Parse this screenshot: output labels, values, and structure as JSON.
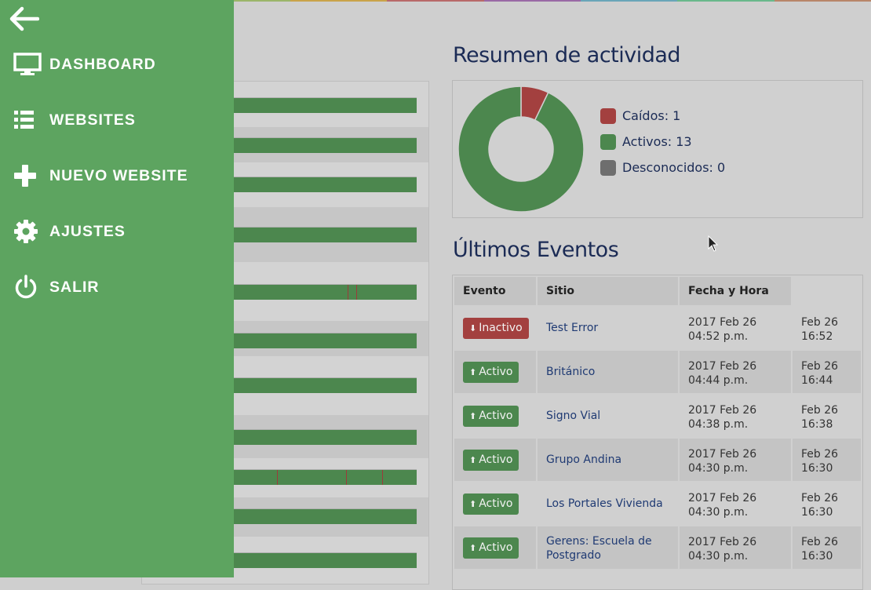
{
  "nav": {
    "items": [
      {
        "label": "DASHBOARD",
        "icon": "monitor-icon"
      },
      {
        "label": "WEBSITES",
        "icon": "list-icon"
      },
      {
        "label": "NUEVO WEBSITE",
        "icon": "plus-icon"
      },
      {
        "label": "AJUSTES",
        "icon": "gear-icon"
      },
      {
        "label": "SALIR",
        "icon": "power-icon"
      }
    ]
  },
  "summary": {
    "title": "Resumen de actividad",
    "legend": [
      {
        "label": "Caídos: 1",
        "color": "#a3403f"
      },
      {
        "label": "Activos: 13",
        "color": "#4c874e"
      },
      {
        "label": "Desconocidos: 0",
        "color": "#6e6e6e"
      }
    ]
  },
  "chart_data": {
    "type": "pie",
    "categories": [
      "Caídos",
      "Activos",
      "Desconocidos"
    ],
    "values": [
      1,
      13,
      0
    ],
    "colors": [
      "#a3403f",
      "#4c874e",
      "#6e6e6e"
    ]
  },
  "events": {
    "title": "Últimos Eventos",
    "headers": [
      "Evento",
      "Sitio",
      "Fecha y Hora"
    ],
    "rows": [
      {
        "status": "Inactivo",
        "state": "down",
        "site": "Test Error",
        "date": "2017 Feb 26",
        "time": "04:52 p.m.",
        "short_date": "Feb 26",
        "short_time": "16:52"
      },
      {
        "status": "Activo",
        "state": "up",
        "site": "Británico",
        "date": "2017 Feb 26",
        "time": "04:44 p.m.",
        "short_date": "Feb 26",
        "short_time": "16:44"
      },
      {
        "status": "Activo",
        "state": "up",
        "site": "Signo Vial",
        "date": "2017 Feb 26",
        "time": "04:38 p.m.",
        "short_date": "Feb 26",
        "short_time": "16:38"
      },
      {
        "status": "Activo",
        "state": "up",
        "site": "Grupo Andina",
        "date": "2017 Feb 26",
        "time": "04:30 p.m.",
        "short_date": "Feb 26",
        "short_time": "16:30"
      },
      {
        "status": "Activo",
        "state": "up",
        "site": "Los Portales Vivienda",
        "date": "2017 Feb 26",
        "time": "04:30 p.m.",
        "short_date": "Feb 26",
        "short_time": "16:30"
      },
      {
        "status": "Activo",
        "state": "up",
        "site": "Gerens: Escuela de Postgrado",
        "date": "2017 Feb 26",
        "time": "04:30 p.m.",
        "short_date": "Feb 26",
        "short_time": "16:30"
      }
    ]
  },
  "colors": {
    "menu": "#5da460",
    "up": "#4c874e",
    "down": "#a3403f",
    "heading": "#1b2b55"
  }
}
